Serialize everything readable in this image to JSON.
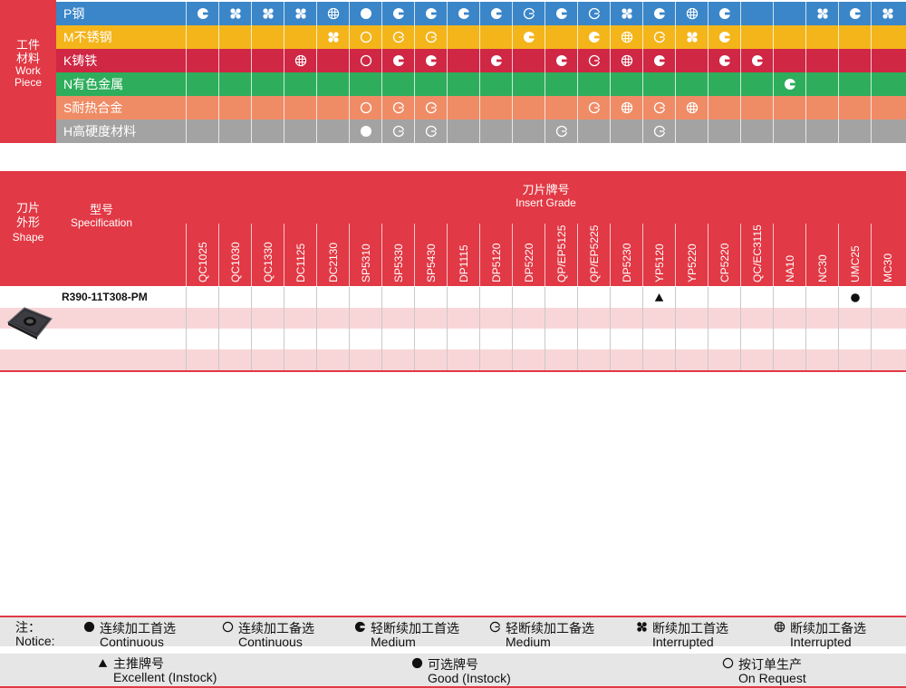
{
  "workpiece": {
    "label_cn_1": "工件",
    "label_cn_2": "材料",
    "label_en_1": "Work",
    "label_en_2": "Piece",
    "rows": [
      {
        "name": "P钢",
        "color": "#3a86c9",
        "cells": [
          "cf",
          "ip",
          "ip",
          "ip",
          "ia",
          "f",
          "cf",
          "cf",
          "cf",
          "cf",
          "co",
          "cf",
          "co",
          "ip",
          "cf",
          "ia",
          "cf",
          "",
          "",
          "ip",
          "cf",
          "ip"
        ]
      },
      {
        "name": "M不锈钢",
        "color": "#f4b51a",
        "cells": [
          "",
          "",
          "",
          "",
          "ip",
          "o",
          "co",
          "co",
          "",
          "",
          "cf",
          "",
          "cf",
          "ia",
          "co",
          "ip",
          "cf",
          "",
          "",
          "",
          "",
          ""
        ]
      },
      {
        "name": "K铸铁",
        "color": "#cf2744",
        "cells": [
          "",
          "",
          "",
          "ia",
          "",
          "o",
          "cf",
          "cf",
          "",
          "cf",
          "",
          "cf",
          "co",
          "ia",
          "cf",
          "",
          "cf",
          "cf",
          "",
          "",
          "",
          ""
        ]
      },
      {
        "name": "N有色金属",
        "color": "#2eae5c",
        "cells": [
          "",
          "",
          "",
          "",
          "",
          "",
          "",
          "",
          "",
          "",
          "",
          "",
          "",
          "",
          "",
          "",
          "",
          "",
          "cf",
          "",
          "",
          ""
        ]
      },
      {
        "name": "S耐热合金",
        "color": "#ef8c66",
        "cells": [
          "",
          "",
          "",
          "",
          "",
          "o",
          "co",
          "co",
          "",
          "",
          "",
          "",
          "co",
          "ia",
          "co",
          "ia",
          "",
          "",
          "",
          "",
          "",
          ""
        ]
      },
      {
        "name": "H高硬度材料",
        "color": "#a3a3a3",
        "cells": [
          "",
          "",
          "",
          "",
          "",
          "f",
          "co",
          "co",
          "",
          "",
          "",
          "co",
          "",
          "",
          "co",
          "",
          "",
          "",
          "",
          "",
          "",
          ""
        ]
      }
    ]
  },
  "grade_table": {
    "shape_cn_1": "刀片",
    "shape_cn_2": "外形",
    "shape_en": "Shape",
    "spec_cn": "型号",
    "spec_en": "Specification",
    "grade_cn": "刀片牌号",
    "grade_en": "Insert Grade",
    "grades": [
      "QC1025",
      "QC1030",
      "QC1330",
      "DC1125",
      "DC2130",
      "SP5310",
      "SP5330",
      "SP5430",
      "DP1115",
      "DP5120",
      "DP5220",
      "QP/EP5125",
      "QP/EP5225",
      "DP5230",
      "YP5120",
      "YP5220",
      "CP5220",
      "QC/EC3115",
      "NA10",
      "NC30",
      "UMC25",
      "MC30"
    ],
    "rows": [
      {
        "model": "R390-11T308-PM",
        "marks": [
          "",
          "",
          "",
          "",
          "",
          "",
          "",
          "",
          "",
          "",
          "",
          "",
          "",
          "",
          "tri",
          "",
          "",
          "",
          "",
          "",
          "dot",
          ""
        ]
      },
      {
        "model": "",
        "marks": [
          "",
          "",
          "",
          "",
          "",
          "",
          "",
          "",
          "",
          "",
          "",
          "",
          "",
          "",
          "",
          "",
          "",
          "",
          "",
          "",
          "",
          ""
        ]
      },
      {
        "model": "",
        "marks": [
          "",
          "",
          "",
          "",
          "",
          "",
          "",
          "",
          "",
          "",
          "",
          "",
          "",
          "",
          "",
          "",
          "",
          "",
          "",
          "",
          "",
          ""
        ]
      },
      {
        "model": "",
        "marks": [
          "",
          "",
          "",
          "",
          "",
          "",
          "",
          "",
          "",
          "",
          "",
          "",
          "",
          "",
          "",
          "",
          "",
          "",
          "",
          "",
          "",
          ""
        ]
      }
    ]
  },
  "legend": {
    "notice_cn": "注：",
    "notice_en": "Notice:",
    "items": [
      {
        "icon": "filled-circle",
        "cn": "连续加工首选",
        "en": "Continuous"
      },
      {
        "icon": "open-circle",
        "cn": "连续加工备选",
        "en": "Continuous"
      },
      {
        "icon": "filled-c",
        "cn": "轻断续加工首选",
        "en": "Medium"
      },
      {
        "icon": "open-c",
        "cn": "轻断续加工备选",
        "en": "Medium"
      },
      {
        "icon": "filled-pinwheel",
        "cn": "断续加工首选",
        "en": "Interrupted"
      },
      {
        "icon": "open-pinwheel",
        "cn": "断续加工备选",
        "en": "Interrupted"
      }
    ],
    "grades": [
      {
        "icon": "triangle",
        "cn": "主推牌号",
        "en": "Excellent (Instock)"
      },
      {
        "icon": "filled-circle",
        "cn": "可选牌号",
        "en": "Good (Instock)"
      },
      {
        "icon": "open-circle",
        "cn": "按订单生产",
        "en": "On Request"
      }
    ]
  }
}
